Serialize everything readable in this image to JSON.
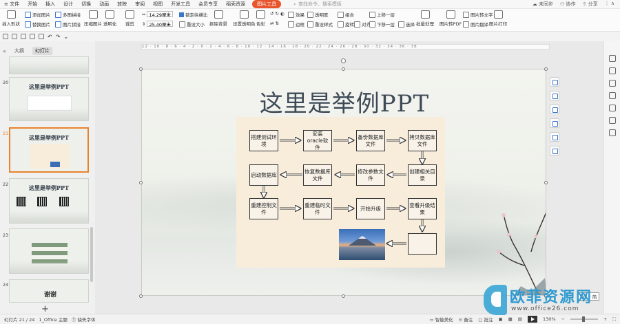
{
  "menu": {
    "file": "文件",
    "items": [
      "开始",
      "插入",
      "设计",
      "切换",
      "动画",
      "放映",
      "审阅",
      "视图",
      "开发工具",
      "会员专享",
      "稻壳资源"
    ],
    "active_tab": "图片工具",
    "search_placeholder": "查找命令、搜索模板",
    "right": [
      "未同步",
      "协作",
      "分享"
    ]
  },
  "ribbon": {
    "insert_image": "插入形状",
    "add_image": "添加图片",
    "replace_image": "替换图片",
    "multi_splice": "多图拼接",
    "image_splice": "图片拼接",
    "compress": "压缩图片",
    "transparency": "透明化",
    "crop": "裁剪",
    "width": "14.29厘米",
    "height": "25.40厘米",
    "lock_ratio": "锁定纵横比",
    "reset_size": "重设大小",
    "remove_bg": "抠除背景",
    "set_transparent": "设置透明色",
    "color": "色彩",
    "effects": "效果",
    "border": "边框",
    "reset_style": "重设样式",
    "transparency2": "透明度",
    "combine": "组合",
    "rotate": "旋转",
    "align": "对齐",
    "bring_forward": "上移一层",
    "send_backward": "下移一层",
    "select": "选择",
    "batch": "批量处理",
    "to_pdf": "图片转PDF",
    "to_text": "图片转文字",
    "translate": "图片翻译",
    "print": "图片打印"
  },
  "left_panel": {
    "tab_outline": "大纲",
    "tab_slides": "幻灯片",
    "collapse": "«",
    "slides": [
      {
        "num": "20",
        "title": "这里是举例PPT"
      },
      {
        "num": "21",
        "title": "这里是举例PPT"
      },
      {
        "num": "22",
        "title": "这里是举例PPT"
      },
      {
        "num": "23",
        "title": ""
      },
      {
        "num": "24",
        "title": "谢谢"
      }
    ],
    "add": "+"
  },
  "ruler": "12 · 10 · 8 · 6 · 4 · 2 · 0 · 2 · 4 · 6 · 8 · 10 · 12 · 14 · 16 · 18 · 20 · 22 · 24 · 26 · 28 · 30 · 32 · 34 · 36 · 38",
  "slide": {
    "title": "这里是举例PPT",
    "flow": [
      "搭建测试环境",
      "安装oracle软件",
      "备份数据库文件",
      "拷贝数据库文件",
      "启动数据库",
      "恢复数据库文件",
      "修改参数文件",
      "创建相关目录",
      "重建控制文件",
      "重建临时文件",
      "开始升级",
      "查看升级结果"
    ]
  },
  "status": {
    "slide_info": "幻灯片 21 / 24",
    "theme": "1_Office 主题",
    "missing_font": "缺失字体",
    "smart_beautify": "智能美化",
    "notes": "备注",
    "comments": "批注",
    "zoom": "130%"
  },
  "ime": "CH ♪ 简",
  "watermark": {
    "name": "欧菲资源网",
    "url": "www.office26.com"
  }
}
